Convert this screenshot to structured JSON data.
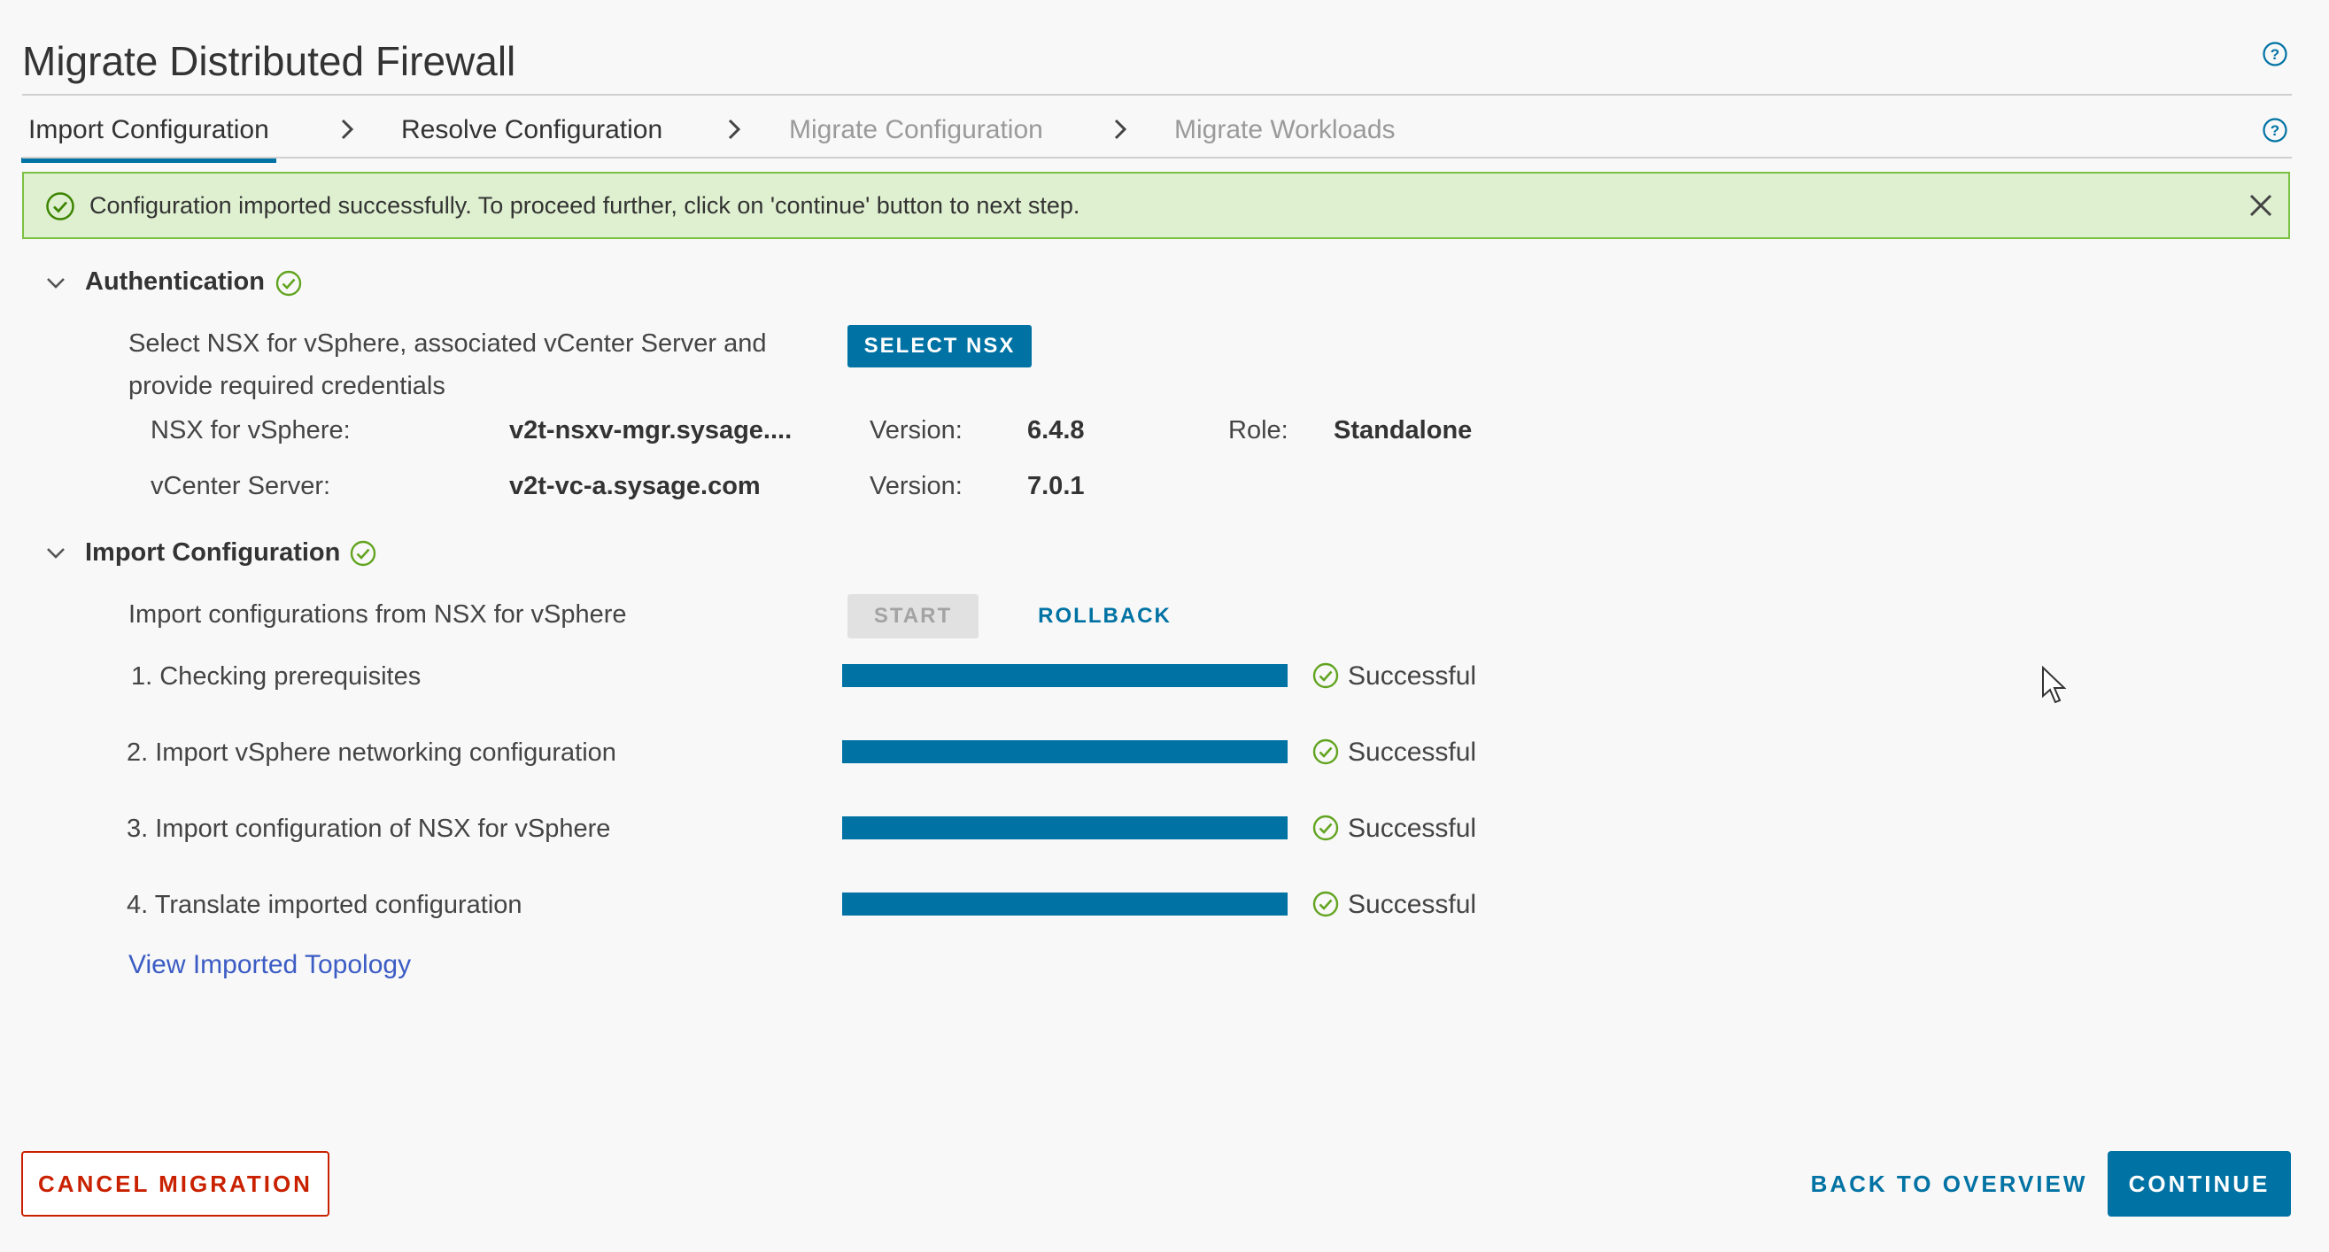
{
  "page": {
    "title": "Migrate Distributed Firewall"
  },
  "wizard": {
    "steps": [
      {
        "label": "Import Configuration",
        "state": "active"
      },
      {
        "label": "Resolve Configuration",
        "state": "enabled"
      },
      {
        "label": "Migrate Configuration",
        "state": "disabled"
      },
      {
        "label": "Migrate Workloads",
        "state": "disabled"
      }
    ]
  },
  "banner": {
    "message": "Configuration imported successfully. To proceed further, click on 'continue' button to next step.",
    "type": "success"
  },
  "authentication": {
    "heading": "Authentication",
    "description_line1": "Select NSX for vSphere, associated vCenter Server and",
    "description_line2": "provide required credentials",
    "select_button": "SELECT NSX",
    "nsx_label": "NSX for vSphere:",
    "nsx_value": "v2t-nsxv-mgr.sysage....",
    "nsx_version_label": "Version:",
    "nsx_version": "6.4.8",
    "role_label": "Role:",
    "role_value": "Standalone",
    "vc_label": "vCenter Server:",
    "vc_value": "v2t-vc-a.sysage.com",
    "vc_version_label": "Version:",
    "vc_version": "7.0.1"
  },
  "import_config": {
    "heading": "Import Configuration",
    "description": "Import configurations from NSX for vSphere",
    "start_button": "START",
    "rollback_button": "ROLLBACK",
    "steps": [
      {
        "label": "1. Checking prerequisites",
        "progress": 1.0,
        "status": "Successful"
      },
      {
        "label": "2. Import vSphere networking configuration",
        "progress": 1.0,
        "status": "Successful"
      },
      {
        "label": "3. Import configuration of NSX for vSphere",
        "progress": 1.0,
        "status": "Successful"
      },
      {
        "label": "4. Translate imported configuration",
        "progress": 1.0,
        "status": "Successful"
      }
    ],
    "topology_link": "View Imported Topology"
  },
  "footer": {
    "cancel": "CANCEL MIGRATION",
    "back": "BACK TO OVERVIEW",
    "continue": "CONTINUE"
  },
  "colors": {
    "primary": "#0072a3",
    "success": "#62a420",
    "danger": "#c92100",
    "banner_bg": "#dff0d0"
  }
}
